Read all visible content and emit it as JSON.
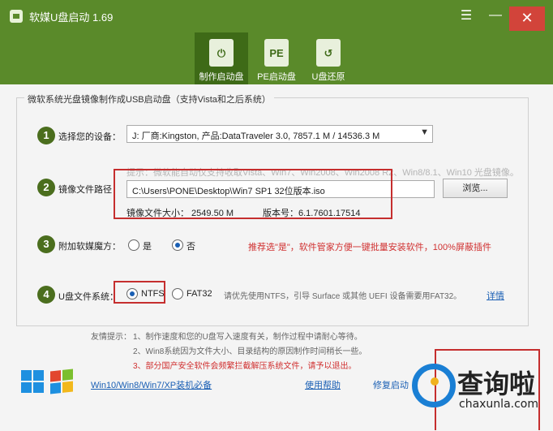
{
  "window": {
    "title": "软媒U盘启动 1.69",
    "menu_icon": "hamburger-icon",
    "min_icon": "minimize-icon",
    "close_icon": "close-icon",
    "menu_glyph": "☰",
    "min_glyph": "—",
    "close_glyph": "✕"
  },
  "tabs": [
    {
      "label": "制作启动盘",
      "icon": "usb-power-icon",
      "glyph": "⏻",
      "active": true
    },
    {
      "label": "PE启动盘",
      "icon": "pe-usb-icon",
      "glyph": "PE",
      "active": false
    },
    {
      "label": "U盘还原",
      "icon": "usb-restore-icon",
      "glyph": "↺",
      "active": false
    }
  ],
  "group_title": "微软系统光盘镜像制作成USB启动盘（支持Vista和之后系统）",
  "steps": {
    "s1": {
      "num": "1",
      "label": "选择您的设备：",
      "select_value": "J: 厂商:Kingston, 产品:DataTraveler 3.0,  7857.1 M / 14536.3 M",
      "arrow": "▼"
    },
    "s2": {
      "num": "2",
      "label": "镜像文件路径",
      "hint": "提示：微软能自动仅支持收取Vista、Win7、Win2008、Win2008 R2、Win8/8.1、Win10 光盘镜像。",
      "path": "C:\\Users\\PONE\\Desktop\\Win7 SP1 32位版本.iso",
      "browse": "浏览...",
      "file_size": "镜像文件大小：    2549.50 M",
      "version": "版本号：6.1.7601.17514"
    },
    "s3": {
      "num": "3",
      "label": "附加软媒魔方：",
      "yes": "是",
      "no": "否",
      "selected": "否",
      "recommend": "推荐选\"是\"，软件管家方便一键批量安装软件，100%屏蔽插件"
    },
    "s4": {
      "num": "4",
      "label": "U盘文件系统：",
      "ntfs": "NTFS",
      "fat32": "FAT32",
      "selected": "NTFS",
      "hint": "请优先使用NTFS，引导 Surface 或其他 UEFI 设备需要用FAT32。",
      "detail": "详情"
    }
  },
  "tips": {
    "title": "友情提示：",
    "t1": "1、制作速度和您的U盘写入速度有关，制作过程中请耐心等待。",
    "t2": "2、Win8系统因为文件大小、目录结构的原因制作时间稍长一些。",
    "t3": "3、部分国产安全软件会频繁拦截解压系统文件，请予以退出。"
  },
  "footer": {
    "win_link": "Win10/Win8/Win7/XP装机必备",
    "help": "使用帮助",
    "repair": "修复启动"
  },
  "watermark": {
    "name": "查询啦",
    "url": "chaxunla.com"
  },
  "colors": {
    "brand_green": "#5a8a2a",
    "active_tab": "#3e6a17",
    "highlight_red": "#c52e2e",
    "link_blue": "#1a5fb4"
  }
}
